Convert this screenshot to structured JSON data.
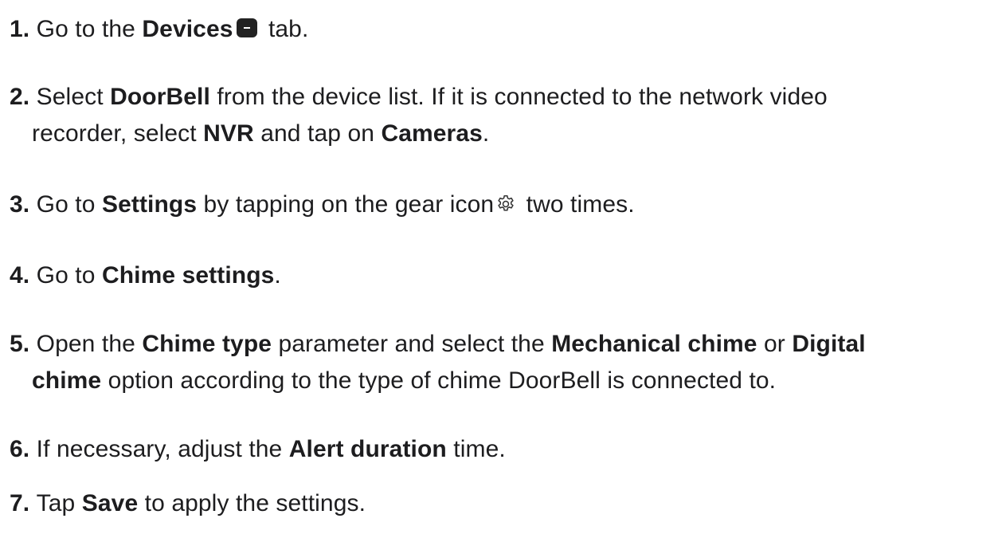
{
  "steps": [
    {
      "num": "1.",
      "parts": [
        "Go to the ",
        "Devices",
        "tab."
      ]
    },
    {
      "num": "2.",
      "parts": [
        "Select ",
        "DoorBell",
        " from the device list. If it is connected to the network video",
        "recorder, select ",
        "NVR",
        " and tap on ",
        "Cameras",
        "."
      ]
    },
    {
      "num": "3.",
      "parts": [
        "Go to ",
        "Settings",
        " by tapping on the gear icon",
        "two times."
      ]
    },
    {
      "num": "4.",
      "parts": [
        "Go to ",
        "Chime settings",
        "."
      ]
    },
    {
      "num": "5.",
      "parts": [
        "Open the ",
        "Chime type",
        " parameter and select the ",
        "Mechanical chime",
        " or ",
        "Digital",
        "chime",
        " option according to the type of chime DoorBell is connected to."
      ]
    },
    {
      "num": "6.",
      "parts": [
        "If necessary, adjust the ",
        "Alert duration",
        " time."
      ]
    },
    {
      "num": "7.",
      "parts": [
        "Tap ",
        "Save",
        " to apply the settings."
      ]
    }
  ],
  "icons": {
    "devices": "devices-tab-icon",
    "gear": "gear-icon"
  }
}
